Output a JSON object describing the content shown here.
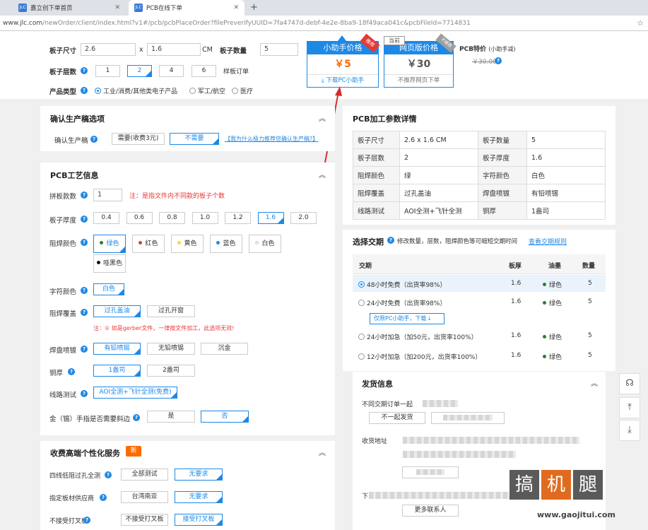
{
  "browser": {
    "tabs": [
      {
        "favicon": "JLC",
        "title": "嘉立创下单首页"
      },
      {
        "favicon": "JLC",
        "title": "PCB在线下单"
      }
    ],
    "new_tab": "+",
    "url_host": "www.jlc.com",
    "url_path": "/newOrder/client/index.html?v1#/pcb/pcbPlaceOrder?filePreverifyUUID=7fa4747d-debf-4e2e-8ba9-18f49aca041c&pcbFileId=7714831"
  },
  "top": {
    "size_label": "板子尺寸",
    "size_w": "2.6",
    "size_x": "x",
    "size_h": "1.6",
    "size_unit": "CM",
    "qty_label": "板子数量",
    "qty": "5",
    "layers_label": "板子层数",
    "layers": [
      "1",
      "2",
      "4",
      "6"
    ],
    "layers_selected": "2",
    "sample_note": "样板订单",
    "type_label": "产品类型",
    "types": [
      "工业/消费/其他类电子产品",
      "军工/航空",
      "医疗"
    ]
  },
  "prices": {
    "helper": {
      "title": "小助手价格",
      "ribbon": "推荐",
      "price": "￥5",
      "action": "下载PC小助手"
    },
    "web": {
      "tag": "当前",
      "title": "网页版价格",
      "ribbon": "不推荐",
      "price": "￥30",
      "action": "不推荐网页下单"
    },
    "special_label": "PCB特价",
    "special_note": "(小助手减)",
    "old_price": "￥30.00"
  },
  "confirm": {
    "title": "确认生产稿选项",
    "label": "确认生产稿",
    "options": [
      "需要(收费3元)",
      "不需要"
    ],
    "link": "【我为什么极力推荐您确认生产稿?】"
  },
  "process": {
    "title": "PCB工艺信息",
    "panel_label": "拼板款数",
    "panel_value": "1",
    "panel_note": "注：是指文件内不同款的板子个数",
    "thick_label": "板子厚度",
    "thick": [
      "0.4",
      "0.6",
      "0.8",
      "1.0",
      "1.2",
      "1.6",
      "2.0"
    ],
    "mask_label": "阻焊颜色",
    "masks": [
      {
        "name": "绿色",
        "color": "#2e7d32"
      },
      {
        "name": "红色",
        "color": "#e53935"
      },
      {
        "name": "黄色",
        "color": "#fdd835"
      },
      {
        "name": "蓝色",
        "color": "#1e88e5"
      },
      {
        "name": "白色",
        "color": "#eeeeee"
      },
      {
        "name": "哑黑色",
        "color": "#111111"
      }
    ],
    "silk_label": "字符颜色",
    "silk": "白色",
    "cover_label": "阻焊覆盖",
    "covers": [
      "过孔盖油",
      "过孔开窗"
    ],
    "cover_note": "注：① 如是gerber文件，一律按文件加工，此选项无效!",
    "surface_label": "焊盘喷镀",
    "surfaces": [
      "有铅喷锡",
      "无铅喷锡",
      "沉金"
    ],
    "copper_label": "铜厚",
    "coppers": [
      "1盎司",
      "2盎司"
    ],
    "test_label": "线路测试",
    "test": "AOI全测+飞针全测(免费)",
    "bevel_label": "金（锡）手指是否需要斜边",
    "bevel": [
      "是",
      "否"
    ]
  },
  "premium": {
    "title": "收费高端个性化服务",
    "badge": "新",
    "rows": [
      {
        "label": "四线低阻过孔全测",
        "options": [
          "全部测试",
          "无要求"
        ]
      },
      {
        "label": "指定板材供应商",
        "options": [
          "台湾南亚",
          "无要求"
        ]
      },
      {
        "label": "不接受打叉板",
        "options": [
          "不接受打叉板",
          "接受打叉板"
        ]
      }
    ]
  },
  "details": {
    "title": "PCB加工参数详情",
    "rows": [
      [
        "板子尺寸",
        "2.6 x 1.6 CM",
        "板子数量",
        "5"
      ],
      [
        "板子层数",
        "2",
        "板子厚度",
        "1.6"
      ],
      [
        "阻焊颜色",
        "绿",
        "字符颜色",
        "白色"
      ],
      [
        "阻焊覆盖",
        "过孔盖油",
        "焊盘喷镀",
        "有铅喷锡"
      ],
      [
        "线路测试",
        "AOI全测+飞针全测",
        "铜厚",
        "1盎司"
      ]
    ]
  },
  "delivery": {
    "title": "选择交期",
    "hint": "修改数量，层数，阻焊颜色等可缩短交期时间",
    "link": "查看交期规则",
    "headers": [
      "交期",
      "板厚",
      "油墨",
      "数量"
    ],
    "rows": [
      {
        "label": "48小时免费（出货率98%）",
        "thick": "1.6",
        "ink": "绿色",
        "qty": "5"
      },
      {
        "label": "24小时免费（出货率98%）",
        "thick": "1.6",
        "ink": "绿色",
        "qty": "5"
      },
      {
        "label": "24小时加急（加50元，出货率100%）",
        "thick": "1.6",
        "ink": "绿色",
        "qty": "5"
      },
      {
        "label": "12小时加急（加200元，出货率100%）",
        "thick": "1.6",
        "ink": "绿色",
        "qty": "5"
      }
    ],
    "helper_only": "仅限PC小助手，下载"
  },
  "shipping": {
    "title": "发货信息",
    "row1_label": "不同交期订单一起",
    "btn1": "不一起发货",
    "address_label": "收货地址",
    "row3_label": "下",
    "more": "更多联系人"
  },
  "watermark": {
    "chars": [
      "搞",
      "机",
      "腿"
    ],
    "url": "www.gaojitui.com"
  },
  "colors": {
    "accent": "#1e88e5",
    "price": "#ff6a00",
    "alert": "#e53935"
  }
}
